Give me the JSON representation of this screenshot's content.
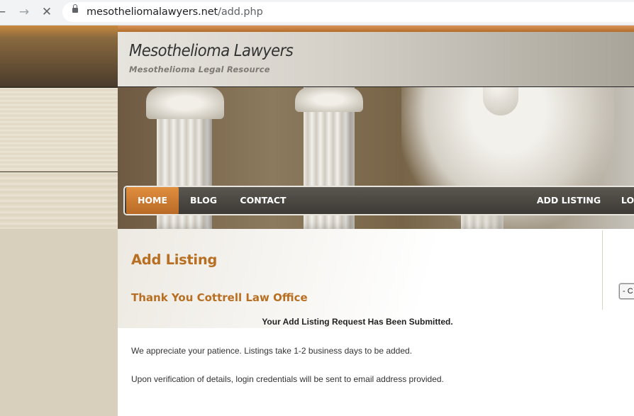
{
  "browser": {
    "url_domain": "mesotheliomalawyers.net",
    "url_path": "/add.php",
    "back_glyph": "←",
    "forward_glyph": "→",
    "stop_glyph": "✕"
  },
  "site": {
    "title": "Mesothelioma Lawyers",
    "tagline": "Mesothelioma Legal Resource"
  },
  "nav": {
    "home": "HOME",
    "blog": "BLOG",
    "contact": "CONTACT",
    "add_listing": "ADD LISTING",
    "login_partial": "LO"
  },
  "content": {
    "heading": "Add Listing",
    "thanks": "Thank You Cottrell Law Office",
    "submitted": "Your Add Listing Request Has Been Submitted.",
    "para1": "We appreciate your patience. Listings take 1-2 business days to be added.",
    "para2": "Upon verification of details, login credentials will be sent to email address provided."
  },
  "sidebar": {
    "select_value": "- C"
  },
  "colors": {
    "accent_orange": "#b86f22",
    "nav_active": "#d07e33"
  }
}
